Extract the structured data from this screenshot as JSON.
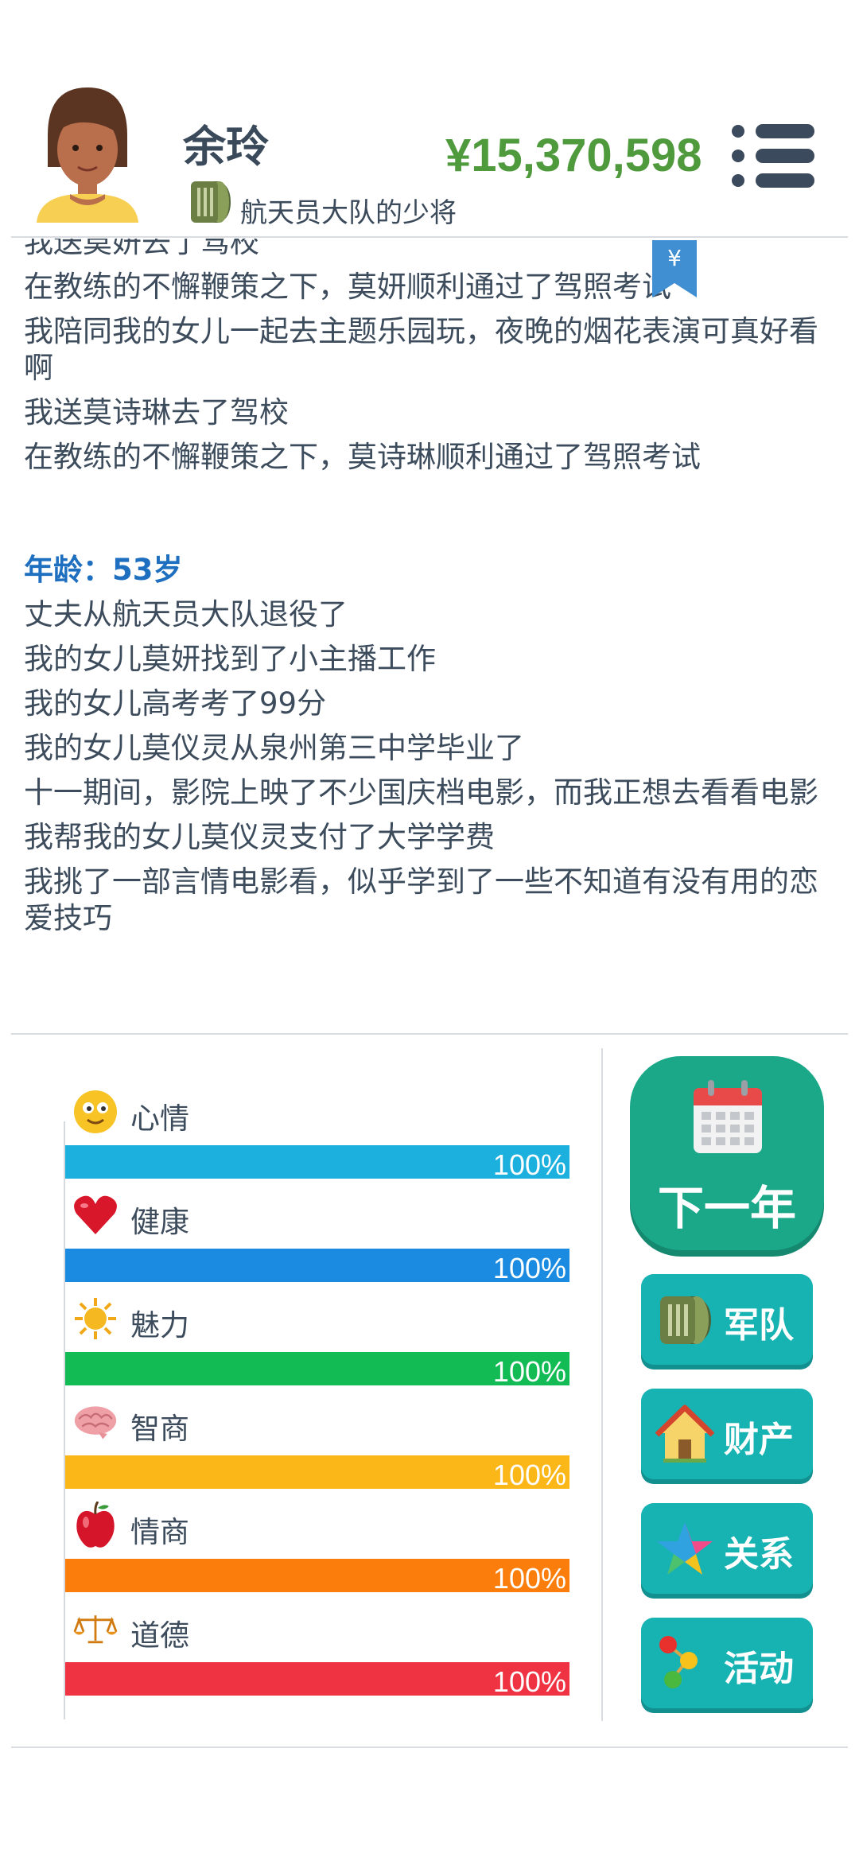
{
  "header": {
    "name": "余玲",
    "title": "航天员大队的少将",
    "money": "¥15,370,598"
  },
  "bookmark": {
    "symbol": "¥"
  },
  "log": {
    "earlier": [
      "我送莫妍去了驾校",
      "在教练的不懈鞭策之下，莫妍顺利通过了驾照考试",
      "我陪同我的女儿一起去主题乐园玩，夜晚的烟花表演可真好看啊",
      "我送莫诗琳去了驾校",
      "在教练的不懈鞭策之下，莫诗琳顺利通过了驾照考试"
    ],
    "age_header": "年龄：53岁",
    "current": [
      "丈夫从航天员大队退役了",
      "我的女儿莫妍找到了小主播工作",
      "我的女儿高考考了99分",
      "我的女儿莫仪灵从泉州第三中学毕业了",
      "十一期间，影院上映了不少国庆档电影，而我正想去看看电影",
      "我帮我的女儿莫仪灵支付了大学学费",
      "我挑了一部言情电影看，似乎学到了一些不知道有没有用的恋爱技巧"
    ]
  },
  "stats": [
    {
      "label": "心情",
      "value": "100%",
      "level": 1.0,
      "color": "#1cb0de",
      "icon": "smiley-icon"
    },
    {
      "label": "健康",
      "value": "100%",
      "level": 1.0,
      "color": "#1a8be0",
      "icon": "heart-icon"
    },
    {
      "label": "魅力",
      "value": "100%",
      "level": 1.0,
      "color": "#12bb54",
      "icon": "sun-icon"
    },
    {
      "label": "智商",
      "value": "100%",
      "level": 1.0,
      "color": "#fbb618",
      "icon": "brain-icon"
    },
    {
      "label": "情商",
      "value": "100%",
      "level": 1.0,
      "color": "#fb7e0c",
      "icon": "apple-icon"
    },
    {
      "label": "道德",
      "value": "100%",
      "level": 1.0,
      "color": "#f03343",
      "icon": "scales-icon"
    }
  ],
  "actions": {
    "next_year": "下一年",
    "army": "军队",
    "property": "财产",
    "relations": "关系",
    "activities": "活动"
  }
}
